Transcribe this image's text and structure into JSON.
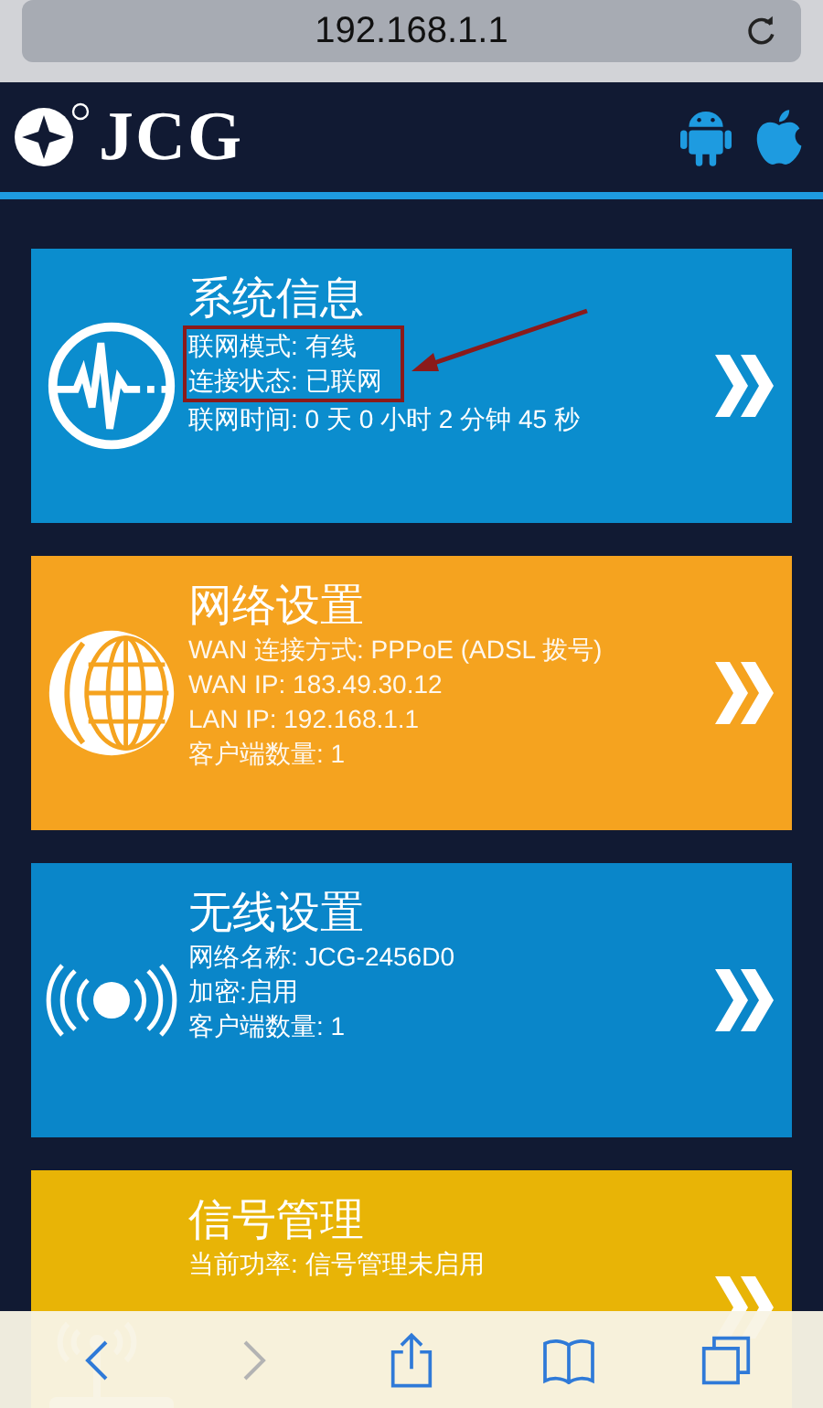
{
  "address_bar": {
    "url": "192.168.1.1"
  },
  "header": {
    "logo_text": "JCG"
  },
  "cards": [
    {
      "kind": "system",
      "color": "#0b8dce",
      "title": "系统信息",
      "lines": [
        {
          "text": "联网模式: 有线",
          "highlighted": true
        },
        {
          "text": "连接状态: 已联网",
          "highlighted": true
        },
        {
          "text": "联网时间: 0 天 0 小时 2 分钟 45 秒",
          "highlighted": false
        }
      ]
    },
    {
      "kind": "network",
      "color": "#f5a31f",
      "title": "网络设置",
      "lines": [
        {
          "text": "WAN 连接方式: PPPoE (ADSL 拨号)",
          "highlighted": false
        },
        {
          "text": "WAN IP: 183.49.30.12",
          "highlighted": false
        },
        {
          "text": "LAN IP: 192.168.1.1",
          "highlighted": false
        },
        {
          "text": "客户端数量: 1",
          "highlighted": false
        }
      ]
    },
    {
      "kind": "wireless",
      "color": "#0a86c9",
      "title": "无线设置",
      "lines": [
        {
          "text": "网络名称: JCG-2456D0",
          "highlighted": false
        },
        {
          "text": "加密:启用",
          "highlighted": false
        },
        {
          "text": "客户端数量: 1",
          "highlighted": false
        }
      ]
    },
    {
      "kind": "signal",
      "color": "#e8b406",
      "title": "信号管理",
      "lines": [
        {
          "text": "当前功率: 信号管理未启用",
          "highlighted": false
        }
      ]
    }
  ],
  "toolbar": [
    {
      "kind": "back",
      "disabled": false
    },
    {
      "kind": "forward",
      "disabled": true
    },
    {
      "kind": "share",
      "disabled": false
    },
    {
      "kind": "bookmarks",
      "disabled": false
    },
    {
      "kind": "tabs",
      "disabled": false
    }
  ]
}
